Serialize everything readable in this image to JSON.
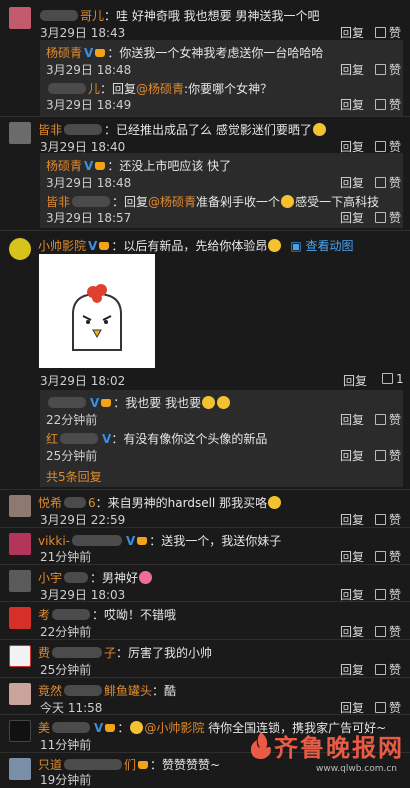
{
  "ui": {
    "reply": "回复",
    "like": "赞",
    "like_count_1": "1"
  },
  "comments": [
    {
      "name_suffix": "哥儿",
      "text": "：哇 好神奇哦 我也想要 男神送我一个吧",
      "date": "3月29日 18:43",
      "replies": [
        {
          "name": "杨硕青",
          "text": "：你送我一个女神我考虑送你一台哈哈哈",
          "date": "3月29日 18:48"
        },
        {
          "name_suffix": "儿",
          "prefix": "：回复",
          "mention": "@杨硕青",
          "text": ":你要哪个女神？",
          "date": "3月29日 18:49"
        }
      ]
    },
    {
      "name": "皆非",
      "text": "：已经推出成品了么 感觉影迷们要晒了",
      "date": "3月29日 18:40",
      "replies": [
        {
          "name": "杨硕青",
          "text": "：还没上市吧应该 快了",
          "date": "3月29日 18:48"
        },
        {
          "name": "皆非",
          "prefix": "：回复",
          "mention": "@杨硕青",
          "text": "准备剁手收一个",
          "text2": "感受一下高科技",
          "date": "3月29日 18:57"
        }
      ]
    },
    {
      "name": "小帅影院",
      "text": "：以后有新品，先给你体验昂",
      "view_image": "查看动图",
      "date": "3月29日 18:02",
      "replies": [
        {
          "text": "：我也要 我也要",
          "date": "22分钟前"
        },
        {
          "name": "红",
          "text": "：有没有像你这个头像的新品",
          "date": "25分钟前"
        }
      ],
      "more": "共5条回复"
    },
    {
      "name": "悦希",
      "name_tail": "6",
      "text": "：来自男神的hardsell 那我买咯",
      "date": "3月29日 22:59"
    },
    {
      "name": "vikki-",
      "text": "：送我一个，我送你妹子",
      "date": "21分钟前"
    },
    {
      "name": "小宇",
      "text": "：男神好",
      "date": "3月29日 18:03"
    },
    {
      "name": "考",
      "text": "：哎呦！不错哦",
      "date": "22分钟前"
    },
    {
      "name": "费",
      "name_tail": "子",
      "text": "：厉害了我的小帅",
      "date": "25分钟前"
    },
    {
      "name": "竟然",
      "name_tail": "鲱鱼罐头",
      "text": "：酷",
      "date": "今天 11:58"
    },
    {
      "name": "美",
      "mention": "@小帅影院",
      "text": "待你全国连锁，携我家广告可好~",
      "date": "11分钟前"
    },
    {
      "name": "只道",
      "name_tail": "们",
      "text": "：赞赞赞赞~",
      "date": "19分钟前"
    }
  ],
  "watermark": {
    "text": "齐鲁晚报网",
    "url": "www.qlwb.com.cn"
  },
  "colors": {
    "username": "#e08a2e",
    "vip": "#3d8ee0",
    "bg": "#1a1a1a",
    "subbox": "#2b2b2b"
  }
}
